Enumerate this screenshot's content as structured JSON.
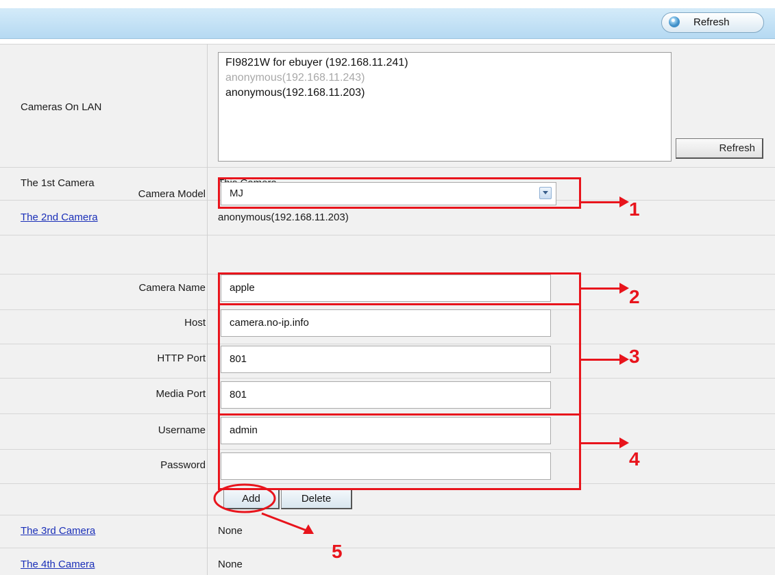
{
  "toolbar": {
    "refresh_label": "Refresh"
  },
  "lan": {
    "label": "Cameras On LAN",
    "items": [
      "FI9821W for ebuyer (192.168.11.241)",
      "anonymous(192.168.11.243)",
      "anonymous(192.168.11.203)"
    ],
    "refresh_label": "Refresh"
  },
  "camera1": {
    "label": "The 1st Camera",
    "value": "This Camera"
  },
  "camera2": {
    "label": "The 2nd Camera",
    "value": "anonymous(192.168.11.203)",
    "fields": {
      "model_label": "Camera Model",
      "model_value": "MJ",
      "name_label": "Camera Name",
      "name_value": "apple",
      "host_label": "Host",
      "host_value": "camera.no-ip.info",
      "http_port_label": "HTTP Port",
      "http_port_value": "801",
      "media_port_label": "Media Port",
      "media_port_value": "801",
      "username_label": "Username",
      "username_value": "admin",
      "password_label": "Password",
      "password_value": ""
    },
    "add_label": "Add",
    "delete_label": "Delete"
  },
  "camera3": {
    "label": "The 3rd Camera",
    "value": "None"
  },
  "camera4": {
    "label": "The 4th Camera",
    "value": "None"
  },
  "annotations": [
    "1",
    "2",
    "3",
    "4",
    "5"
  ],
  "colors": {
    "annotation": "#e8141c",
    "link": "#1a2fb8",
    "header": "#c6e3f7"
  }
}
